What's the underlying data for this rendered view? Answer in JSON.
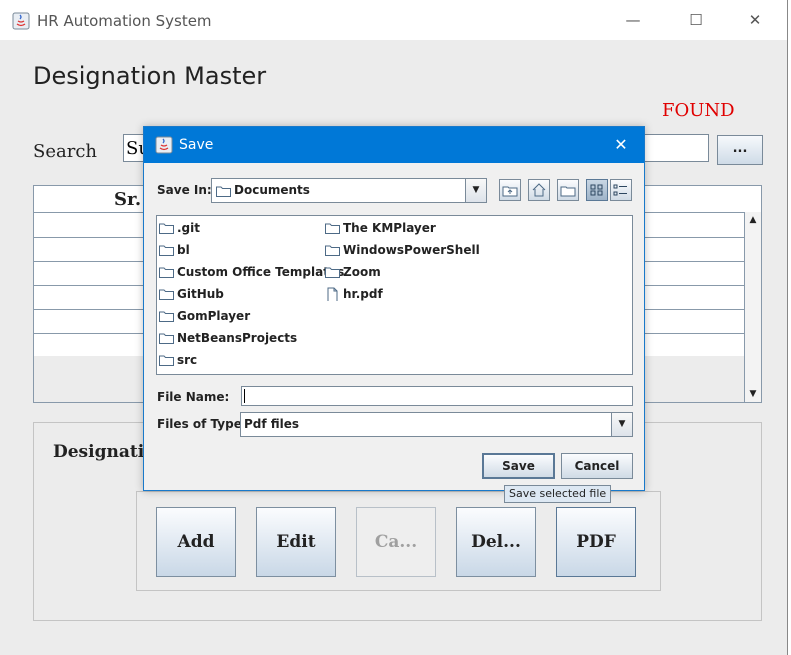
{
  "window": {
    "title": "HR Automation System",
    "controls": {
      "minimize": "—",
      "maximize": "☐",
      "close": "✕"
    }
  },
  "main": {
    "heading": "Designation Master",
    "found_label": "FOUND",
    "search_label": "Search",
    "search_value": "Su",
    "browse_label": "...",
    "table_header": "Sr.",
    "panel_title": "Designatio",
    "buttons": {
      "add": "Add",
      "edit": "Edit",
      "cancel": "Ca...",
      "delete": "Del...",
      "pdf": "PDF"
    }
  },
  "save_dialog": {
    "title": "Save",
    "close": "✕",
    "save_in_label": "Save In:",
    "save_in_value": "Documents",
    "files_left": [
      ".git",
      "bl",
      "Custom Office Templates",
      "GitHub",
      "GomPlayer",
      "NetBeansProjects",
      "src"
    ],
    "files_right": [
      "The KMPlayer",
      "WindowsPowerShell",
      "Zoom",
      "hr.pdf"
    ],
    "file_name_label": "File Name:",
    "file_name_value": "",
    "files_of_type_label": "Files of Type:",
    "files_of_type_value": "Pdf files",
    "save_button": "Save",
    "cancel_button": "Cancel",
    "tooltip": "Save selected file"
  }
}
